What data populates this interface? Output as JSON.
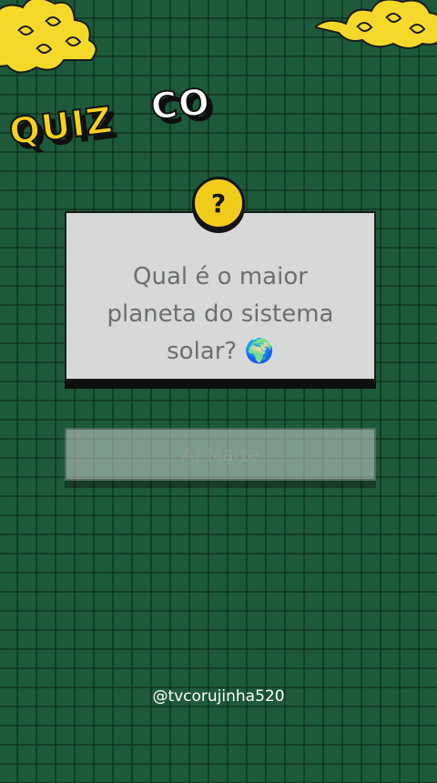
{
  "title": {
    "quiz": "QUIZ",
    "co": "CO"
  },
  "question": {
    "badge": "?",
    "text": "Qual é o maior planeta do sistema solar? 🌍"
  },
  "answers": [
    {
      "label": "A) Marte"
    }
  ],
  "footer": {
    "handle": "@tvcorujinha520"
  },
  "colors": {
    "background": "#1c5a3a",
    "grid": "#0a2818",
    "accent_yellow": "#f2cc1b",
    "card": "#d7d9d8",
    "question_text": "#6c6f6d"
  },
  "icons": [
    "cloud-left-icon",
    "cloud-right-icon",
    "question-mark-icon"
  ]
}
